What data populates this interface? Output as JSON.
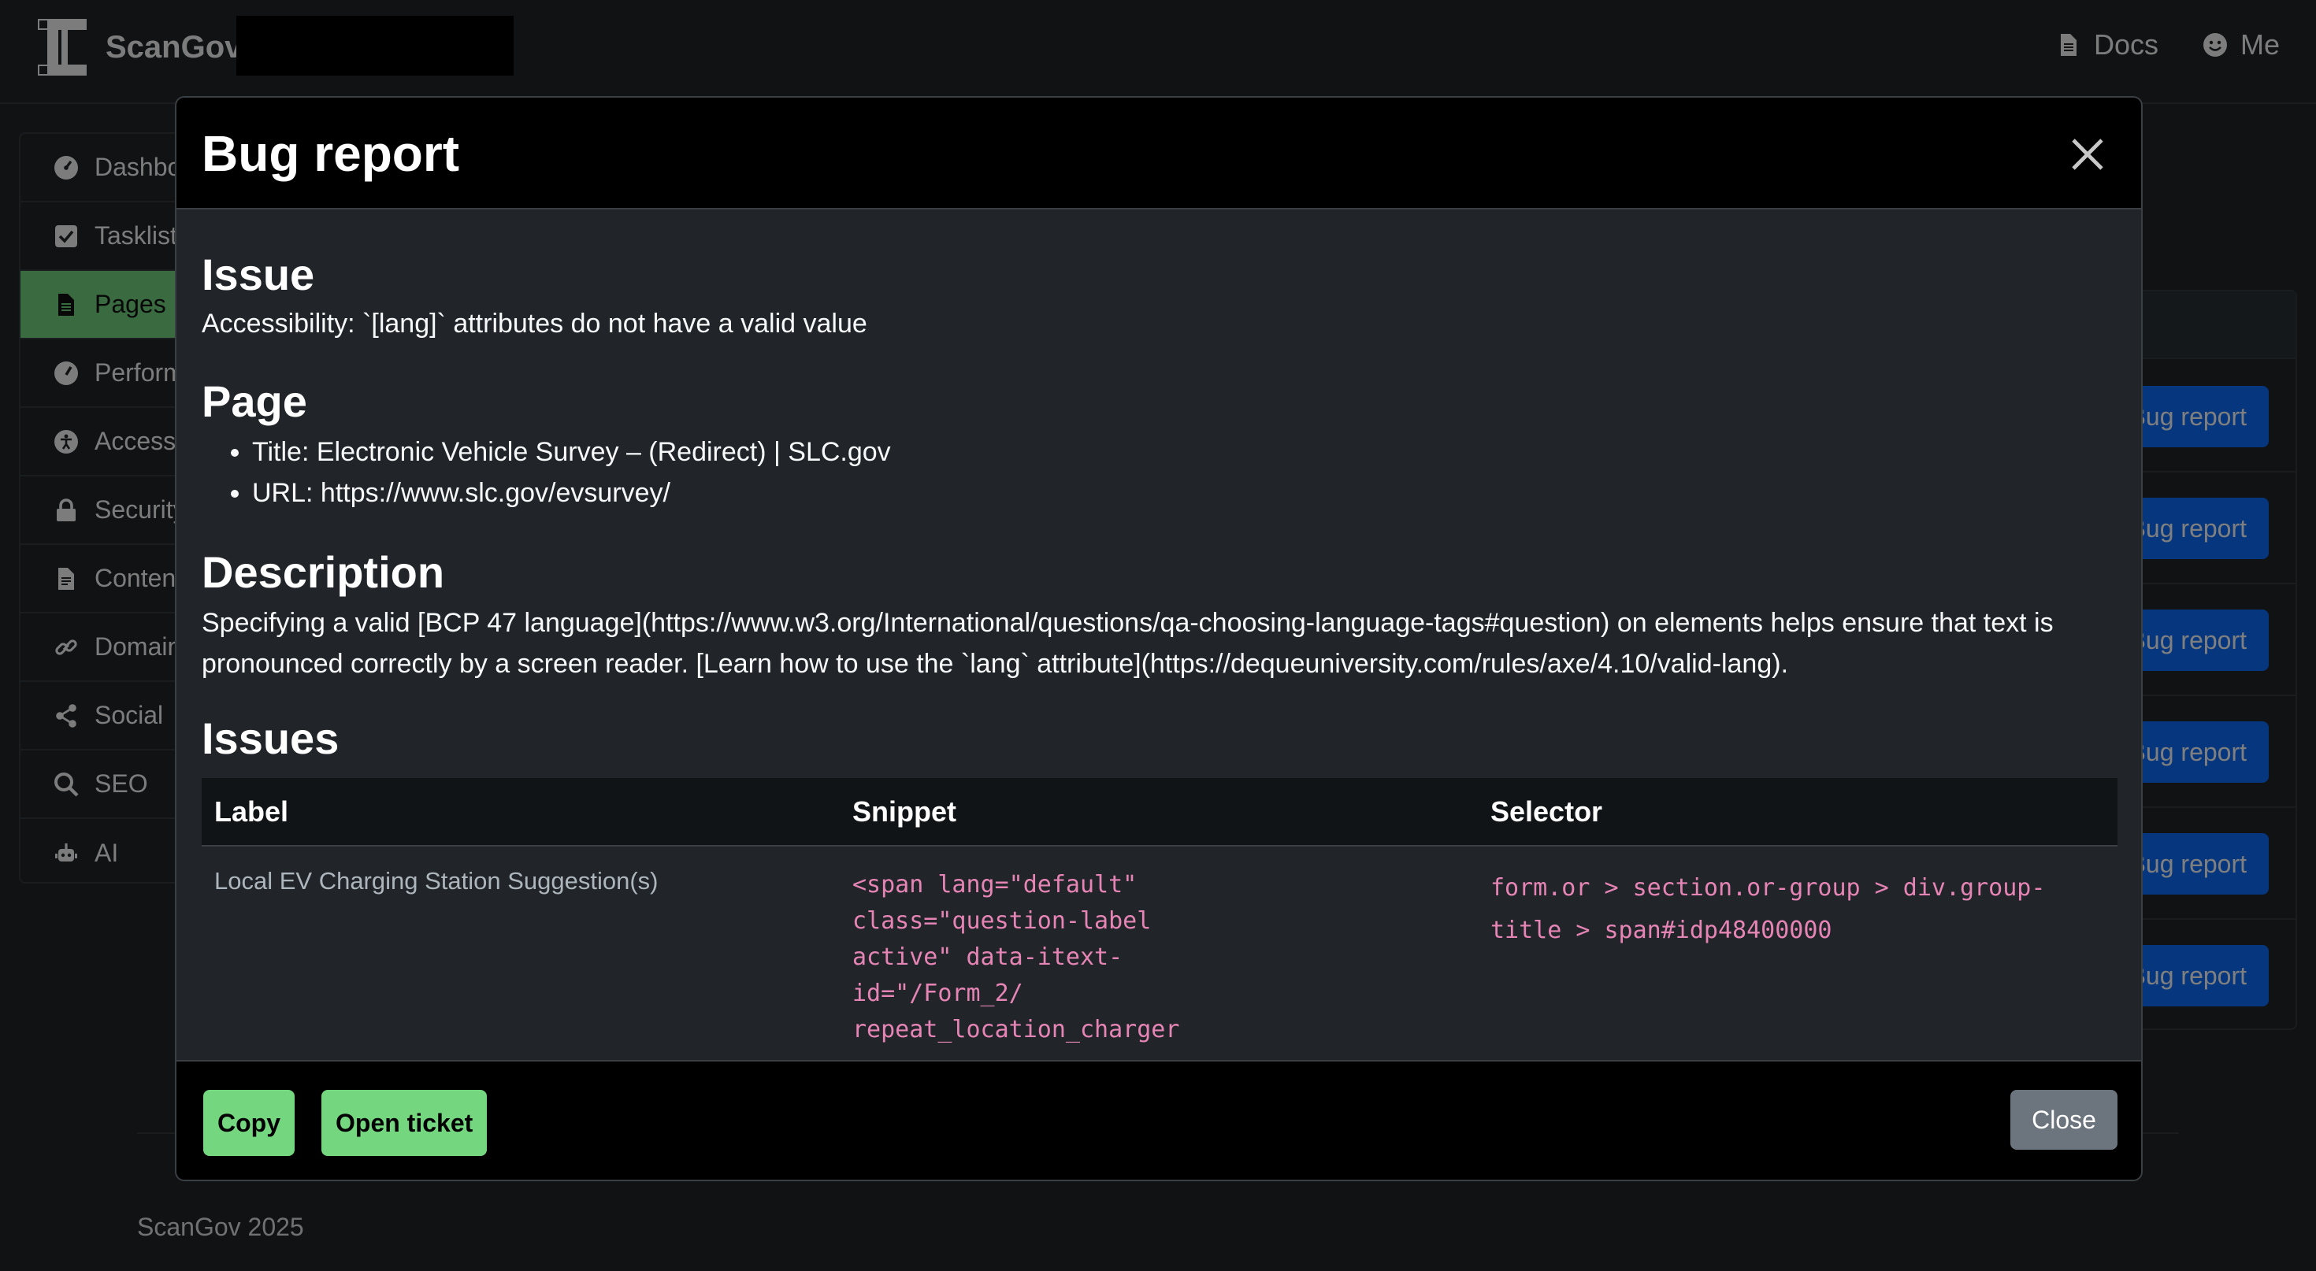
{
  "navbar": {
    "brand": "ScanGov",
    "links": [
      {
        "label": "Docs",
        "icon": "file-icon"
      },
      {
        "label": "Me",
        "icon": "smiley-icon"
      }
    ]
  },
  "sidebar": {
    "items": [
      {
        "label": "Dashboard",
        "icon": "dashboard-icon",
        "active": false
      },
      {
        "label": "Tasklist",
        "icon": "checkbox-icon",
        "active": false
      },
      {
        "label": "Pages",
        "icon": "file-icon",
        "active": true
      },
      {
        "label": "Performance",
        "icon": "gauge-icon",
        "active": false
      },
      {
        "label": "Accessibility",
        "icon": "accessibility-icon",
        "active": false
      },
      {
        "label": "Security",
        "icon": "lock-icon",
        "active": false
      },
      {
        "label": "Content",
        "icon": "document-icon",
        "active": false
      },
      {
        "label": "Domain",
        "icon": "link-icon",
        "active": false
      },
      {
        "label": "Social",
        "icon": "share-icon",
        "active": false
      },
      {
        "label": "SEO",
        "icon": "search-icon",
        "active": false
      },
      {
        "label": "AI",
        "icon": "robot-icon",
        "active": false
      }
    ]
  },
  "background": {
    "row_button_label": "Bug report"
  },
  "modal": {
    "title": "Bug report",
    "issue_heading": "Issue",
    "issue_text": "Accessibility: `[lang]` attributes do not have a valid value",
    "page_heading": "Page",
    "page_title_item": "Title: Electronic Vehicle Survey – (Redirect) | SLC.gov",
    "page_url_item": "URL: https://www.slc.gov/evsurvey/",
    "description_heading": "Description",
    "description_text": "Specifying a valid [BCP 47 language](https://www.w3.org/International/questions/qa-choosing-language-tags#question) on elements helps ensure that text is pronounced correctly by a screen reader. [Learn how to use the `lang` attribute](https://dequeuniversity.com/rules/axe/4.10/valid-lang).",
    "issues_heading": "Issues",
    "table": {
      "columns": [
        "Label",
        "Snippet",
        "Selector"
      ],
      "rows": [
        {
          "label": "Local EV Charging Station Suggestion(s)",
          "snippet": "<span lang=\"default\"\nclass=\"question-label\nactive\" data-itext-\nid=\"/Form_2/\nrepeat_location_charger",
          "selector": "form.or > section.or-group > div.group-\ntitle > span#idp48400000"
        }
      ]
    },
    "buttons": {
      "copy": "Copy",
      "open_ticket": "Open ticket",
      "close": "Close"
    }
  },
  "footer": {
    "text": "ScanGov 2025"
  },
  "colors": {
    "accent_green": "#75d680",
    "primary_blue": "#0d6efd",
    "code_pink": "#e685b5",
    "secondary_gray": "#6c757d"
  }
}
